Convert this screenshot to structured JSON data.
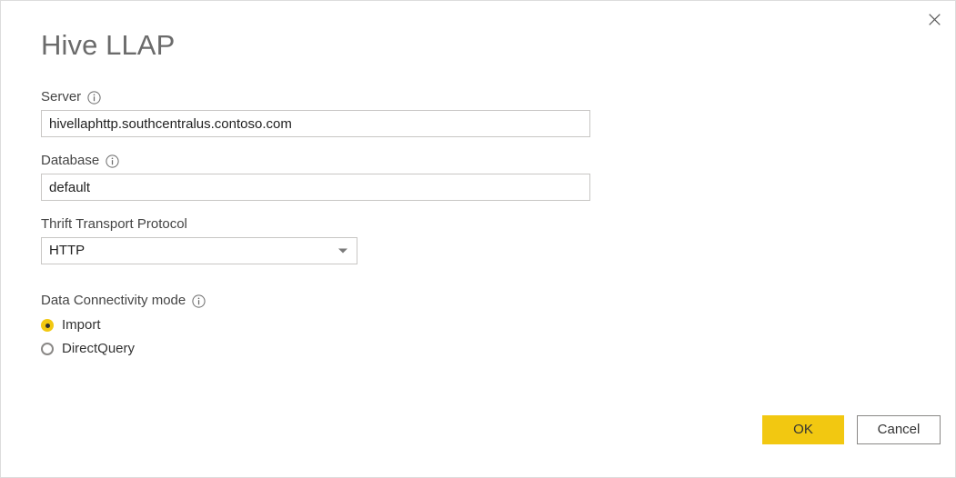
{
  "dialog": {
    "title": "Hive LLAP",
    "close_icon": "close-icon"
  },
  "fields": {
    "server": {
      "label": "Server",
      "info_icon": "info-icon",
      "value": "hivellaphttp.southcentralus.contoso.com",
      "placeholder": ""
    },
    "database": {
      "label": "Database",
      "info_icon": "info-icon",
      "value": "default",
      "placeholder": ""
    },
    "thrift_transport_protocol": {
      "label": "Thrift Transport Protocol",
      "selected": "HTTP",
      "arrow_icon": "chevron-down-icon"
    },
    "data_connectivity_mode": {
      "label": "Data Connectivity mode",
      "info_icon": "info-icon",
      "selected": "Import",
      "options": [
        {
          "label": "Import",
          "selected": true
        },
        {
          "label": "DirectQuery",
          "selected": false
        }
      ]
    }
  },
  "footer": {
    "ok_label": "OK",
    "cancel_label": "Cancel"
  },
  "colors": {
    "accent": "#F2C811",
    "border": "#C8C6C4",
    "title_text": "#6B6B6B",
    "body_text": "#333333"
  }
}
